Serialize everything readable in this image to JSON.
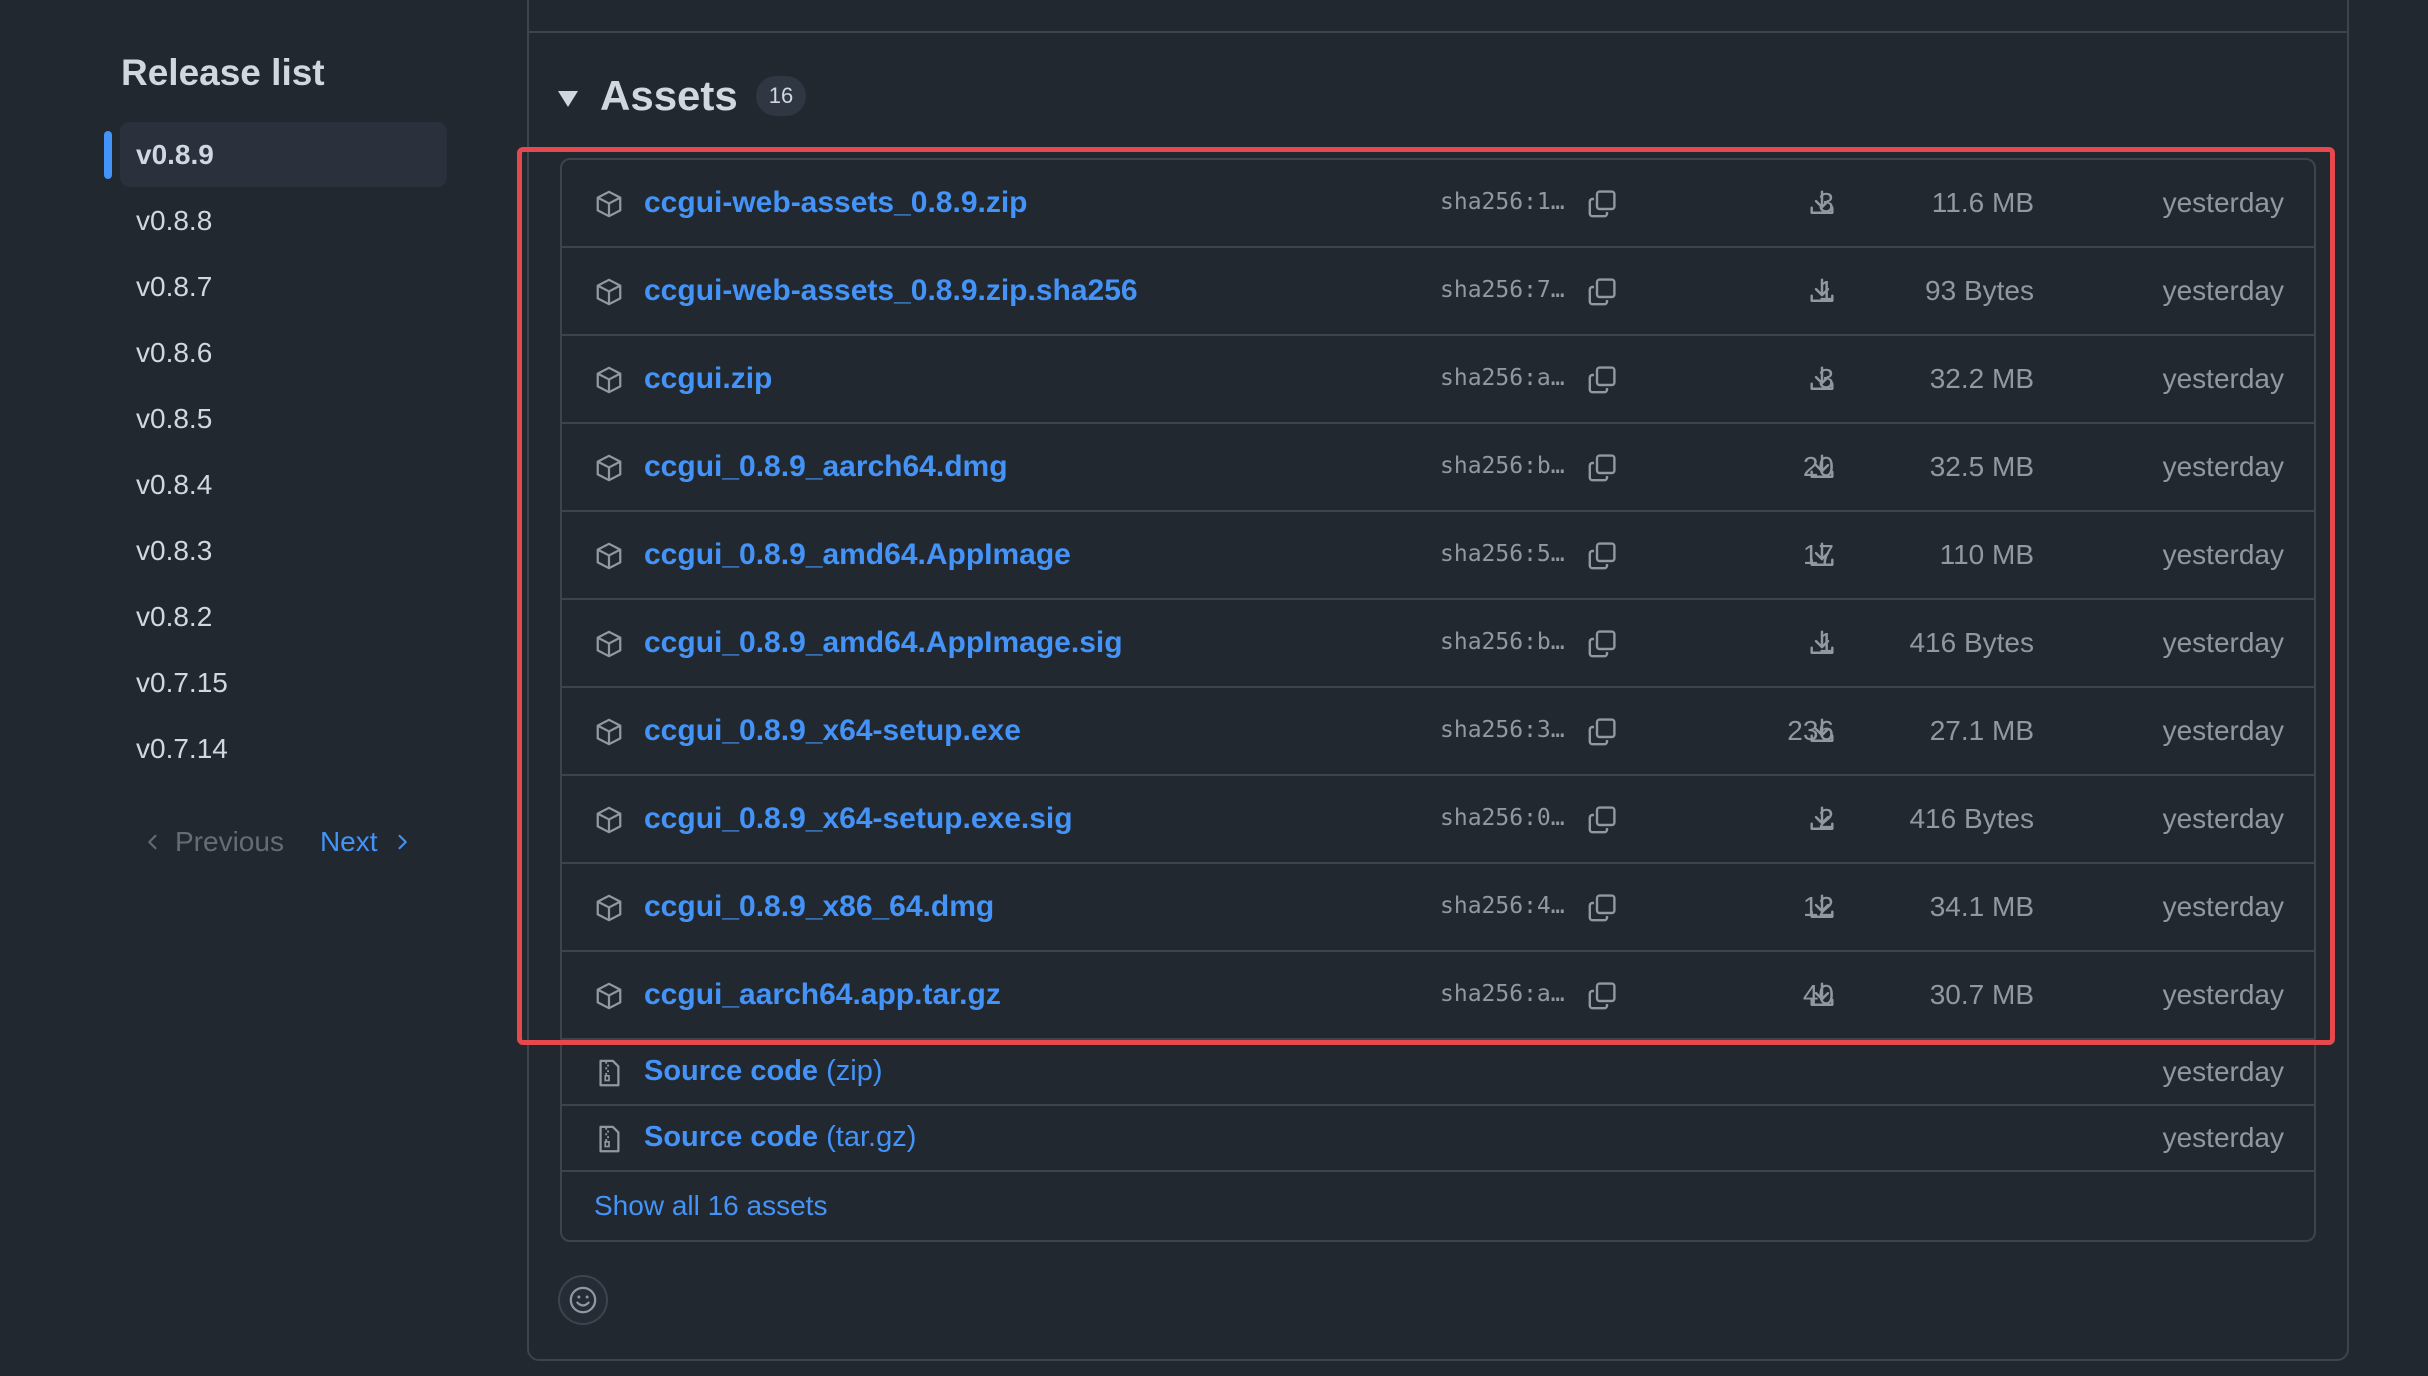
{
  "sidebar": {
    "title": "Release list",
    "items": [
      {
        "label": "v0.8.9",
        "active": true
      },
      {
        "label": "v0.8.8"
      },
      {
        "label": "v0.8.7"
      },
      {
        "label": "v0.8.6"
      },
      {
        "label": "v0.8.5"
      },
      {
        "label": "v0.8.4"
      },
      {
        "label": "v0.8.3"
      },
      {
        "label": "v0.8.2"
      },
      {
        "label": "v0.7.15"
      },
      {
        "label": "v0.7.14"
      }
    ],
    "previous_label": "Previous",
    "next_label": "Next"
  },
  "assets": {
    "title": "Assets",
    "count": "16",
    "files": [
      {
        "name": "ccgui-web-assets_0.8.9.zip",
        "sha": "sha256:1…",
        "downloads": "3",
        "size": "11.6 MB",
        "date": "yesterday"
      },
      {
        "name": "ccgui-web-assets_0.8.9.zip.sha256",
        "sha": "sha256:7…",
        "downloads": "1",
        "size": "93 Bytes",
        "date": "yesterday"
      },
      {
        "name": "ccgui.zip",
        "sha": "sha256:a…",
        "downloads": "3",
        "size": "32.2 MB",
        "date": "yesterday"
      },
      {
        "name": "ccgui_0.8.9_aarch64.dmg",
        "sha": "sha256:b…",
        "downloads": "20",
        "size": "32.5 MB",
        "date": "yesterday"
      },
      {
        "name": "ccgui_0.8.9_amd64.AppImage",
        "sha": "sha256:5…",
        "downloads": "17",
        "size": "110 MB",
        "date": "yesterday"
      },
      {
        "name": "ccgui_0.8.9_amd64.AppImage.sig",
        "sha": "sha256:b…",
        "downloads": "1",
        "size": "416 Bytes",
        "date": "yesterday"
      },
      {
        "name": "ccgui_0.8.9_x64-setup.exe",
        "sha": "sha256:3…",
        "downloads": "236",
        "size": "27.1 MB",
        "date": "yesterday"
      },
      {
        "name": "ccgui_0.8.9_x64-setup.exe.sig",
        "sha": "sha256:0…",
        "downloads": "2",
        "size": "416 Bytes",
        "date": "yesterday"
      },
      {
        "name": "ccgui_0.8.9_x86_64.dmg",
        "sha": "sha256:4…",
        "downloads": "12",
        "size": "34.1 MB",
        "date": "yesterday"
      },
      {
        "name": "ccgui_aarch64.app.tar.gz",
        "sha": "sha256:a…",
        "downloads": "40",
        "size": "30.7 MB",
        "date": "yesterday"
      }
    ],
    "source": [
      {
        "label": "Source code",
        "format": "(zip)",
        "date": "yesterday"
      },
      {
        "label": "Source code",
        "format": "(tar.gz)",
        "date": "yesterday"
      }
    ],
    "show_all_label": "Show all 16 assets"
  },
  "colors": {
    "background": "#212830",
    "link": "#4493f8",
    "muted": "#9198a1",
    "highlight": "#e5484d"
  }
}
